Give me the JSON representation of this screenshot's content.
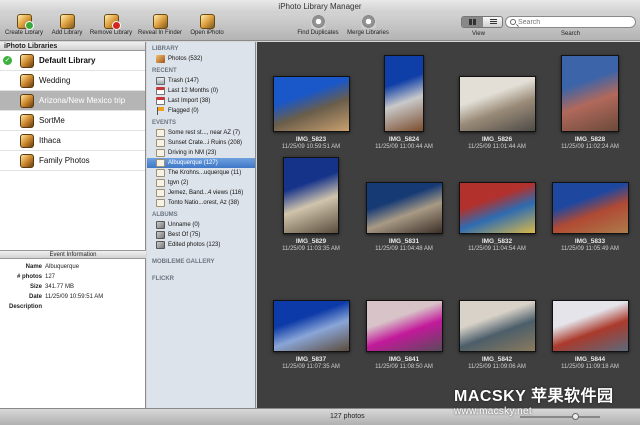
{
  "window": {
    "title": "iPhoto Library Manager"
  },
  "toolbar": {
    "buttons": [
      {
        "label": "Create Library",
        "icon": "photo-library-plus-icon"
      },
      {
        "label": "Add Library",
        "icon": "photo-library-add-icon"
      },
      {
        "label": "Remove Library",
        "icon": "photo-library-remove-icon"
      },
      {
        "label": "Reveal In Finder",
        "icon": "photo-library-reveal-icon"
      },
      {
        "label": "Open iPhoto",
        "icon": "iphoto-icon"
      },
      {
        "label": "Find Duplicates",
        "icon": "gear-icon"
      },
      {
        "label": "Merge Libraries",
        "icon": "merge-icon"
      }
    ],
    "view_label": "View",
    "search_label": "Search",
    "search_placeholder": "Search"
  },
  "libraries": {
    "header": "iPhoto Libraries",
    "items": [
      {
        "name": "Default Library",
        "active": true
      },
      {
        "name": "Wedding"
      },
      {
        "name": "Arizona/New Mexico trip",
        "selected": true
      },
      {
        "name": "SortMe"
      },
      {
        "name": "Ithaca"
      },
      {
        "name": "Family Photos"
      }
    ]
  },
  "event_info": {
    "header": "Event Information",
    "rows": [
      {
        "key": "Name",
        "value": "Albuquerque"
      },
      {
        "key": "# photos",
        "value": "127"
      },
      {
        "key": "Size",
        "value": "341.77 MB"
      },
      {
        "key": "Date",
        "value": "11/25/09 10:59:51 AM"
      },
      {
        "key": "Description",
        "value": ""
      }
    ]
  },
  "source": {
    "library_header": "LIBRARY",
    "library_items": [
      {
        "label": "Photos (532)",
        "icon": "photos-icon"
      }
    ],
    "recent_header": "RECENT",
    "recent_items": [
      {
        "label": "Trash (147)",
        "icon": "trash-icon"
      },
      {
        "label": "Last 12 Months (0)",
        "icon": "calendar-icon"
      },
      {
        "label": "Last Import (38)",
        "icon": "calendar-icon"
      },
      {
        "label": "Flagged (0)",
        "icon": "flag-icon"
      }
    ],
    "events_header": "EVENTS",
    "events_items": [
      {
        "label": "Some rest st..., near AZ (7)"
      },
      {
        "label": "Sunset Crate...i Ruins (208)"
      },
      {
        "label": "Driving in NM (23)"
      },
      {
        "label": "Albuquerque (127)",
        "selected": true
      },
      {
        "label": "The Krohns...uquerque (11)"
      },
      {
        "label": "tgvn (2)"
      },
      {
        "label": "Jemez, Band...4 views (116)"
      },
      {
        "label": "Tonto Natio...orest, Az (38)"
      }
    ],
    "albums_header": "ALBUMS",
    "albums_items": [
      {
        "label": "Unname (0)"
      },
      {
        "label": "Best Of (75)"
      },
      {
        "label": "Edited photos (123)"
      }
    ],
    "mobileme_header": "MOBILEME GALLERY",
    "flickr_header": "FLICKR"
  },
  "photos": [
    {
      "name": "IMG_5823",
      "date": "11/25/09 10:59:51 AM",
      "colors": [
        "#1a57c8",
        "#6a5e4a",
        "#caa070"
      ],
      "w": 77,
      "h": 56
    },
    {
      "name": "IMG_5824",
      "date": "11/25/09 11:00:44 AM",
      "colors": [
        "#0e3ea8",
        "#c9c9c9",
        "#7b4d2d"
      ],
      "w": 40,
      "h": 77
    },
    {
      "name": "IMG_5826",
      "date": "11/25/09 11:01:44 AM",
      "colors": [
        "#e3dfd6",
        "#9a8b78",
        "#4d4a46"
      ],
      "w": 77,
      "h": 56
    },
    {
      "name": "IMG_5828",
      "date": "11/25/09 11:02:24 AM",
      "colors": [
        "#3c64a8",
        "#b1695b",
        "#6a4a3b"
      ],
      "w": 58,
      "h": 77
    },
    {
      "name": "IMG_5829",
      "date": "11/25/09 11:03:35 AM",
      "colors": [
        "#16338a",
        "#d0c4ac",
        "#5a4d3c"
      ],
      "w": 56,
      "h": 77
    },
    {
      "name": "IMG_5831",
      "date": "11/25/09 11:04:48 AM",
      "colors": [
        "#153a74",
        "#a89a84",
        "#3b2f28"
      ],
      "w": 77,
      "h": 52
    },
    {
      "name": "IMG_5832",
      "date": "11/25/09 11:04:54 AM",
      "colors": [
        "#b2312d",
        "#2e6cb1",
        "#d9b949"
      ],
      "w": 77,
      "h": 52
    },
    {
      "name": "IMG_5833",
      "date": "11/25/09 11:05:49 AM",
      "colors": [
        "#1e47a0",
        "#b04a33",
        "#ad7b4b"
      ],
      "w": 77,
      "h": 52
    },
    {
      "name": "IMG_5837",
      "date": "11/25/09 11:07:35 AM",
      "colors": [
        "#0c3aa8",
        "#8aa6d8",
        "#5c4b3a"
      ],
      "w": 77,
      "h": 52
    },
    {
      "name": "IMG_5841",
      "date": "11/25/09 11:08:50 AM",
      "colors": [
        "#d8c4c8",
        "#c2199a",
        "#5a4a5a"
      ],
      "w": 77,
      "h": 52
    },
    {
      "name": "IMG_5842",
      "date": "11/25/09 11:09:06 AM",
      "colors": [
        "#d8d2c8",
        "#4c5e6a",
        "#8b7a5e"
      ],
      "w": 77,
      "h": 52
    },
    {
      "name": "IMG_5844",
      "date": "11/25/09 11:09:18 AM",
      "colors": [
        "#e4e4ea",
        "#aa3a2c",
        "#5b6a7c"
      ],
      "w": 77,
      "h": 52
    }
  ],
  "status": {
    "count": "127 photos"
  },
  "watermark": {
    "big": "MACSKY 苹果软件园",
    "small": "www.macsky.net"
  }
}
